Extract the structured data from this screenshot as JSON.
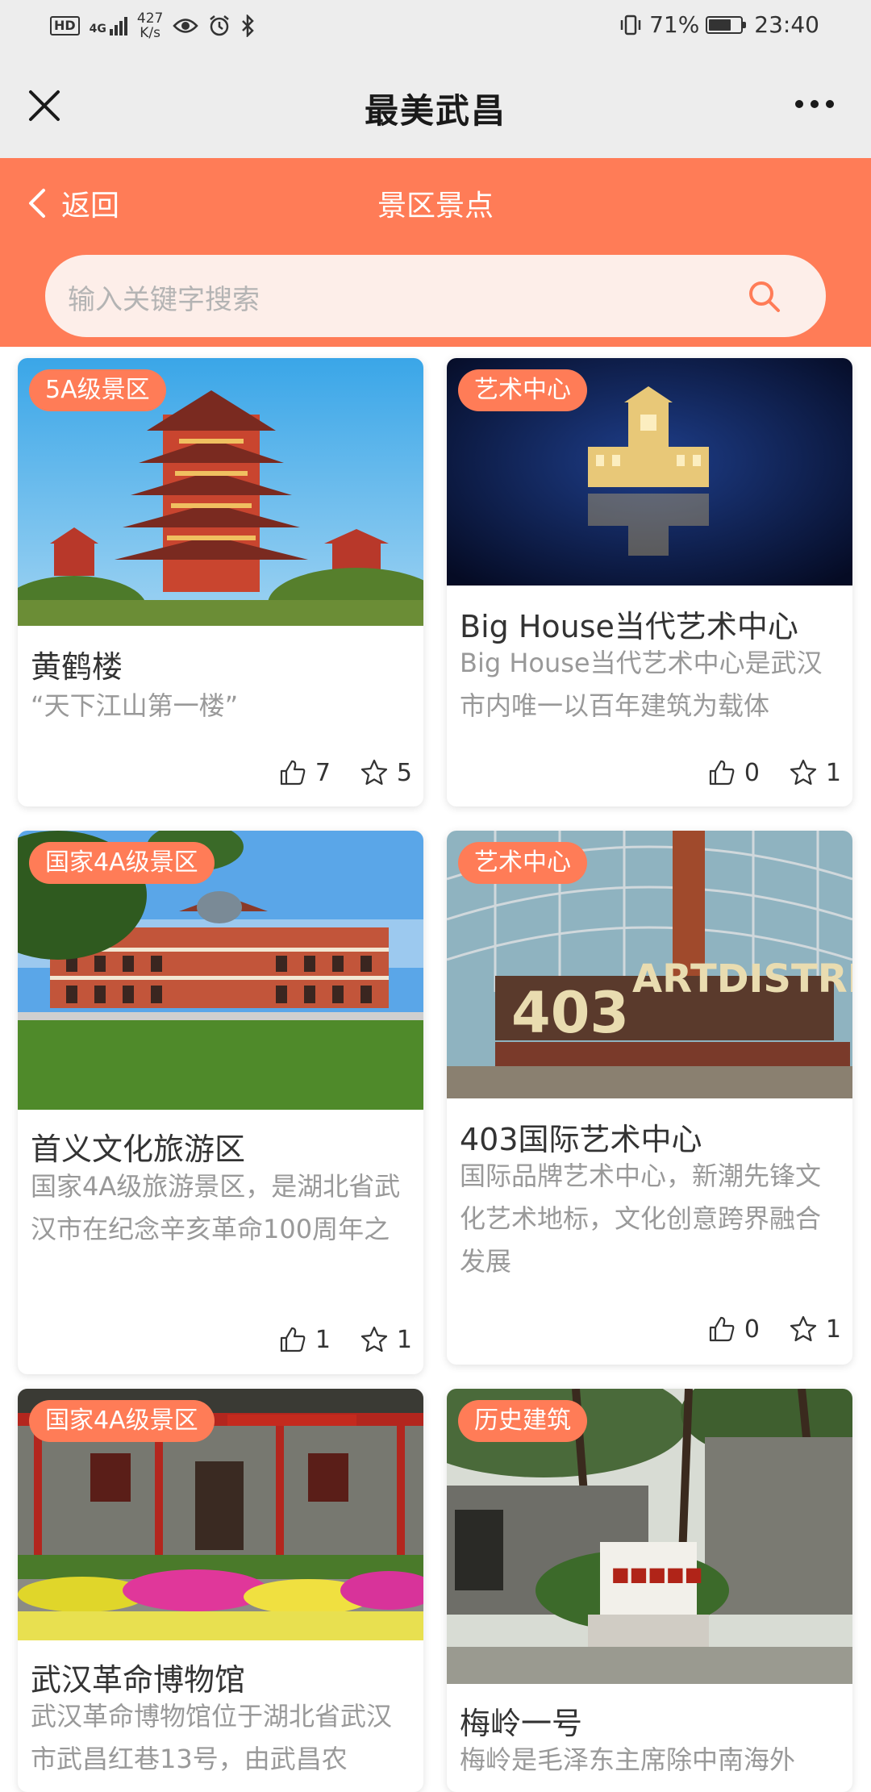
{
  "status_bar": {
    "hd": "HD",
    "net": "4G",
    "speed_value": "427",
    "speed_unit": "K/s",
    "battery_percent": "71%",
    "battery_level": 0.71,
    "time": "23:40"
  },
  "navbar": {
    "title": "最美武昌"
  },
  "header": {
    "back_label": "返回",
    "title": "景区景点"
  },
  "search": {
    "placeholder": "输入关键字搜索"
  },
  "cards": [
    {
      "tag": "5A级景区",
      "title": "黄鹤楼",
      "desc": "“天下江山第一楼”",
      "likes": "7",
      "stars": "5"
    },
    {
      "tag": "艺术中心",
      "title": "Big House当代艺术中心",
      "desc": "Big House当代艺术中心是武汉市内唯一以百年建筑为载体",
      "likes": "0",
      "stars": "1"
    },
    {
      "tag": "国家4A级景区",
      "title": "首义文化旅游区",
      "desc": "国家4A级旅游景区，是湖北省武汉市在纪念辛亥革命100周年之",
      "likes": "1",
      "stars": "1"
    },
    {
      "tag": "艺术中心",
      "title": "403国际艺术中心",
      "desc": "国际品牌艺术中心，新潮先锋文化艺术地标，文化创意跨界融合发展",
      "likes": "0",
      "stars": "1"
    },
    {
      "tag": "国家4A级景区",
      "title": "武汉革命博物馆",
      "desc": "武汉革命博物馆位于湖北省武汉市武昌红巷13号，由武昌农",
      "likes": "",
      "stars": ""
    },
    {
      "tag": "历史建筑",
      "title": "梅岭一号",
      "desc": "梅岭是毛泽东主席除中南海外",
      "likes": "",
      "stars": ""
    }
  ],
  "colors": {
    "accent": "#ff7c57",
    "nav_bg": "#ededed"
  }
}
